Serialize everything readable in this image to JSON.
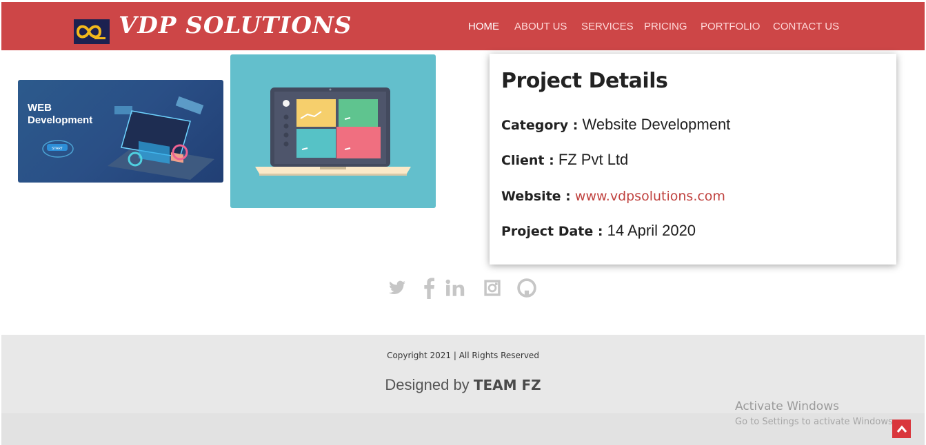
{
  "header": {
    "brand": "VDP SOLUTIONS",
    "logo_text": "VDP",
    "nav": [
      {
        "label": "HOME",
        "active": true
      },
      {
        "label": "ABOUT US",
        "active": false
      },
      {
        "label": "SERVICES",
        "active": false
      },
      {
        "label": "PRICING",
        "active": false
      },
      {
        "label": "PORTFOLIO",
        "active": false
      },
      {
        "label": "CONTACT US",
        "active": false
      }
    ],
    "colors": {
      "bar": "#cd4647",
      "logo_bg": "#1c2150"
    }
  },
  "gallery": {
    "image1": {
      "line1": "WEB",
      "line2": "Development",
      "button": "START",
      "icon": "web-development-illustration"
    },
    "image2": {
      "icon": "laptop-dashboard-illustration"
    }
  },
  "project": {
    "title": "Project Details",
    "category_label": "Category :",
    "category_value": "Website Development",
    "client_label": "Client :",
    "client_value": "FZ Pvt Ltd",
    "website_label": "Website :",
    "website_value": "www.vdpsolutions.com",
    "date_label": "Project Date :",
    "date_value": "14 April 2020"
  },
  "social": [
    {
      "name": "twitter-icon"
    },
    {
      "name": "facebook-icon"
    },
    {
      "name": "linkedin-icon"
    },
    {
      "name": "instagram-icon"
    },
    {
      "name": "github-icon"
    }
  ],
  "footer": {
    "copyright": "Copyright 2021 | All Rights Reserved",
    "designed_prefix": "Designed by",
    "designed_team": "TEAM FZ"
  },
  "watermark": {
    "line1": "Activate Windows",
    "line2": "Go to Settings to activate Windows."
  },
  "accent": "#c0423f"
}
